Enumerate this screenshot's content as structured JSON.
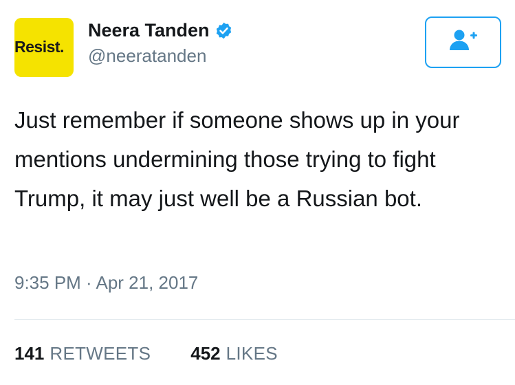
{
  "author": {
    "avatar_text": "Resist.",
    "display_name": "Neera Tanden",
    "handle": "@neeratanden",
    "verified": true
  },
  "follow_button": {
    "icon": "add-user-icon"
  },
  "tweet": {
    "text": "Just remember if someone shows up in your mentions undermining those trying to fight Trump, it may just well be a Russian bot.",
    "timestamp": "9:35 PM · Apr 21, 2017"
  },
  "stats": {
    "retweets_count": "141",
    "retweets_label": "RETWEETS",
    "likes_count": "452",
    "likes_label": "LIKES"
  },
  "colors": {
    "accent": "#1da1f2",
    "avatar_background": "#f5e300",
    "secondary_text": "#657786",
    "primary_text": "#14171a"
  }
}
